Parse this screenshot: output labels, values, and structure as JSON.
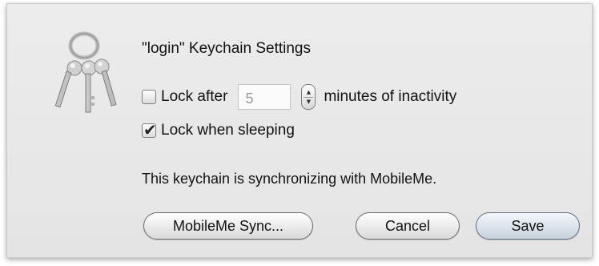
{
  "dialog": {
    "title": "\"login\" Keychain Settings",
    "icon": "keychain-keys-icon",
    "lock_after": {
      "checked": false,
      "label": "Lock after",
      "minutes_value": "5",
      "suffix": "minutes of inactivity"
    },
    "lock_when_sleeping": {
      "checked": true,
      "label": "Lock when sleeping"
    },
    "sync_message": "This keychain is synchronizing with MobileMe.",
    "buttons": {
      "sync_label": "MobileMe Sync...",
      "cancel_label": "Cancel",
      "save_label": "Save"
    }
  },
  "colors": {
    "sheet_background": "#e8e8e8",
    "default_button_tint": "#c8d1db"
  }
}
